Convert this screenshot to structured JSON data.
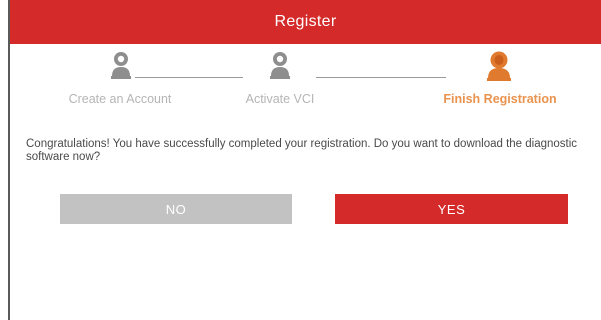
{
  "dialog": {
    "title": "Register",
    "steps": [
      {
        "label": "Create an Account",
        "state": "inactive",
        "icon": "user-icon"
      },
      {
        "label": "Activate VCI",
        "state": "inactive",
        "icon": "user-icon"
      },
      {
        "label": "Finish Registration",
        "state": "active",
        "icon": "user-icon"
      }
    ],
    "message": "Congratulations! You have successfully completed your registration. Do you want to download the diagnostic software now?",
    "buttons": {
      "no_label": "NO",
      "yes_label": "YES"
    }
  },
  "colors": {
    "brand_red": "#d42a2a",
    "active_step": "#e9934e",
    "inactive_step": "#b5b5b5",
    "disabled_button": "#c2c2c2"
  }
}
